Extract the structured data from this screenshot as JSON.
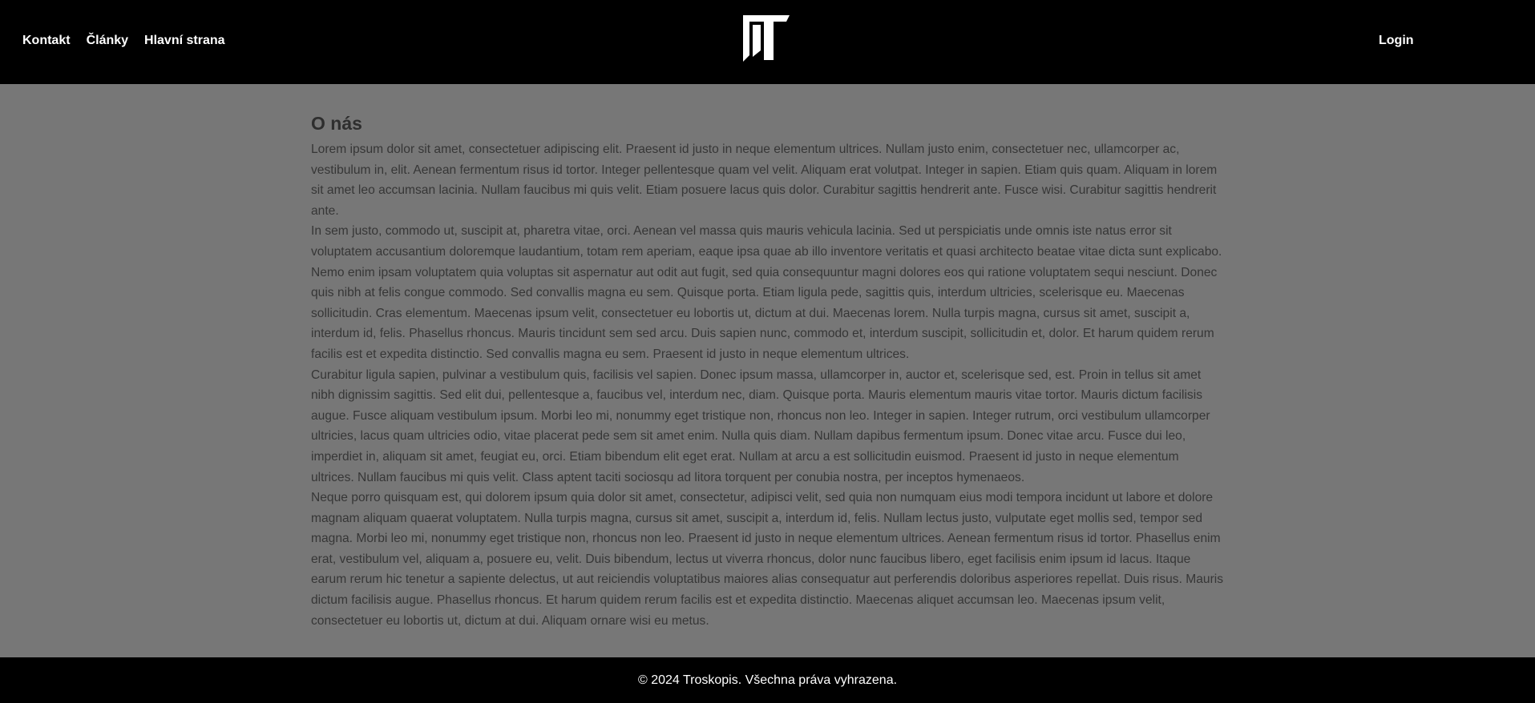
{
  "header": {
    "nav": [
      {
        "label": "Kontakt"
      },
      {
        "label": "Články"
      },
      {
        "label": "Hlavní strana"
      }
    ],
    "logo_icon": "troskopis-logo-icon",
    "login_label": "Login"
  },
  "main": {
    "title": "O nás",
    "paragraphs": [
      "Lorem ipsum dolor sit amet, consectetuer adipiscing elit. Praesent id justo in neque elementum ultrices. Nullam justo enim, consectetuer nec, ullamcorper ac, vestibulum in, elit. Aenean fermentum risus id tortor. Integer pellentesque quam vel velit. Aliquam erat volutpat. Integer in sapien. Etiam quis quam. Aliquam in lorem sit amet leo accumsan lacinia. Nullam faucibus mi quis velit. Etiam posuere lacus quis dolor. Curabitur sagittis hendrerit ante. Fusce wisi. Curabitur sagittis hendrerit ante.",
      "In sem justo, commodo ut, suscipit at, pharetra vitae, orci. Aenean vel massa quis mauris vehicula lacinia. Sed ut perspiciatis unde omnis iste natus error sit voluptatem accusantium doloremque laudantium, totam rem aperiam, eaque ipsa quae ab illo inventore veritatis et quasi architecto beatae vitae dicta sunt explicabo. Nemo enim ipsam voluptatem quia voluptas sit aspernatur aut odit aut fugit, sed quia consequuntur magni dolores eos qui ratione voluptatem sequi nesciunt. Donec quis nibh at felis congue commodo. Sed convallis magna eu sem. Quisque porta. Etiam ligula pede, sagittis quis, interdum ultricies, scelerisque eu. Maecenas sollicitudin. Cras elementum. Maecenas ipsum velit, consectetuer eu lobortis ut, dictum at dui. Maecenas lorem. Nulla turpis magna, cursus sit amet, suscipit a, interdum id, felis. Phasellus rhoncus. Mauris tincidunt sem sed arcu. Duis sapien nunc, commodo et, interdum suscipit, sollicitudin et, dolor. Et harum quidem rerum facilis est et expedita distinctio. Sed convallis magna eu sem. Praesent id justo in neque elementum ultrices.",
      "Curabitur ligula sapien, pulvinar a vestibulum quis, facilisis vel sapien. Donec ipsum massa, ullamcorper in, auctor et, scelerisque sed, est. Proin in tellus sit amet nibh dignissim sagittis. Sed elit dui, pellentesque a, faucibus vel, interdum nec, diam. Quisque porta. Mauris elementum mauris vitae tortor. Mauris dictum facilisis augue. Fusce aliquam vestibulum ipsum. Morbi leo mi, nonummy eget tristique non, rhoncus non leo. Integer in sapien. Integer rutrum, orci vestibulum ullamcorper ultricies, lacus quam ultricies odio, vitae placerat pede sem sit amet enim. Nulla quis diam. Nullam dapibus fermentum ipsum. Donec vitae arcu. Fusce dui leo, imperdiet in, aliquam sit amet, feugiat eu, orci. Etiam bibendum elit eget erat. Nullam at arcu a est sollicitudin euismod. Praesent id justo in neque elementum ultrices. Nullam faucibus mi quis velit. Class aptent taciti sociosqu ad litora torquent per conubia nostra, per inceptos hymenaeos.",
      "Neque porro quisquam est, qui dolorem ipsum quia dolor sit amet, consectetur, adipisci velit, sed quia non numquam eius modi tempora incidunt ut labore et dolore magnam aliquam quaerat voluptatem. Nulla turpis magna, cursus sit amet, suscipit a, interdum id, felis. Nullam lectus justo, vulputate eget mollis sed, tempor sed magna. Morbi leo mi, nonummy eget tristique non, rhoncus non leo. Praesent id justo in neque elementum ultrices. Aenean fermentum risus id tortor. Phasellus enim erat, vestibulum vel, aliquam a, posuere eu, velit. Duis bibendum, lectus ut viverra rhoncus, dolor nunc faucibus libero, eget facilisis enim ipsum id lacus. Itaque earum rerum hic tenetur a sapiente delectus, ut aut reiciendis voluptatibus maiores alias consequatur aut perferendis doloribus asperiores repellat. Duis risus. Mauris dictum facilisis augue. Phasellus rhoncus. Et harum quidem rerum facilis est et expedita distinctio. Maecenas aliquet accumsan leo. Maecenas ipsum velit, consectetuer eu lobortis ut, dictum at dui. Aliquam ornare wisi eu metus."
    ]
  },
  "footer": {
    "text": "© 2024 Troskopis. Všechna práva vyhrazena."
  },
  "colors": {
    "header_bg": "#000000",
    "page_bg": "#777777",
    "text": "#363636",
    "nav_text": "#ffffff"
  }
}
